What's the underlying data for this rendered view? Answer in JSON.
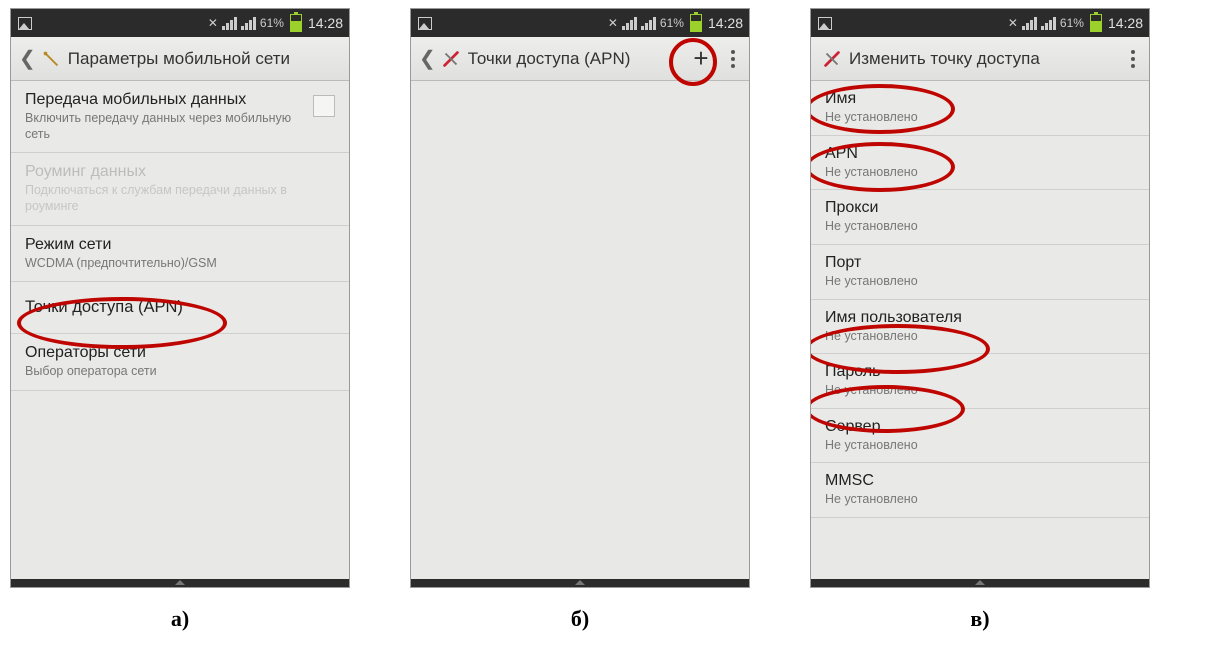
{
  "status": {
    "battery_pct": "61%",
    "time": "14:28"
  },
  "captions": {
    "a": "а)",
    "b": "б)",
    "c": "в)"
  },
  "screenA": {
    "title": "Параметры мобильной сети",
    "items": [
      {
        "title": "Передача мобильных данных",
        "sub": "Включить передачу данных через мобильную сеть",
        "checkbox": true
      },
      {
        "title": "Роуминг данных",
        "sub": "Подключаться к службам передачи данных в роуминге",
        "disabled": true
      },
      {
        "title": "Режим сети",
        "sub": "WCDMA (предпочтительно)/GSM"
      },
      {
        "title": "Точки доступа (APN)"
      },
      {
        "title": "Операторы сети",
        "sub": "Выбор оператора сети"
      }
    ]
  },
  "screenB": {
    "title": "Точки доступа (APN)"
  },
  "screenC": {
    "title": "Изменить точку доступа",
    "not_set": "Не установлено",
    "items": [
      {
        "title": "Имя"
      },
      {
        "title": "APN"
      },
      {
        "title": "Прокси"
      },
      {
        "title": "Порт"
      },
      {
        "title": "Имя пользователя"
      },
      {
        "title": "Пароль"
      },
      {
        "title": "Сервер"
      },
      {
        "title": "MMSC"
      }
    ]
  }
}
